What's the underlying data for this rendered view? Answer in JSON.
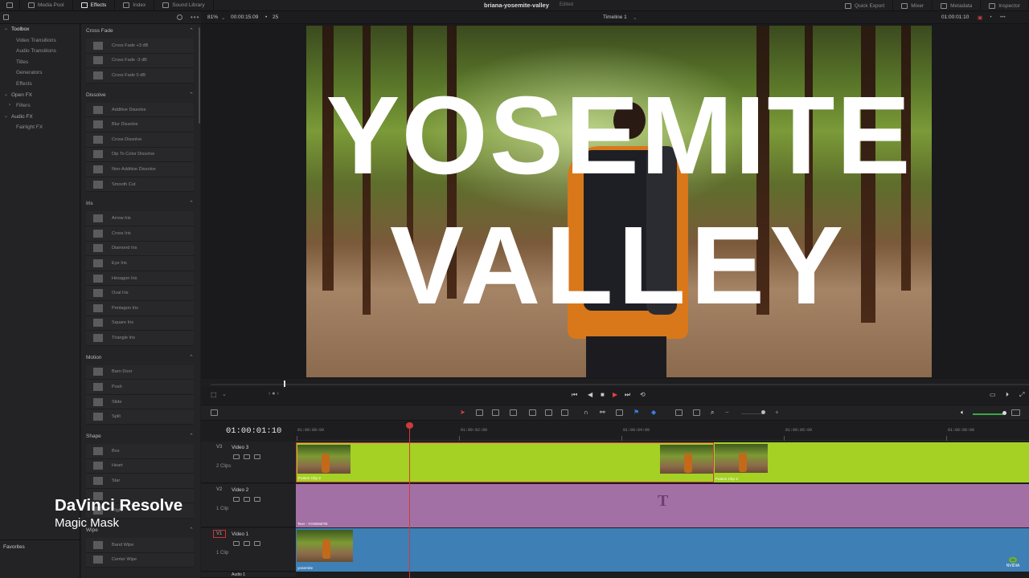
{
  "topbar": {
    "tabs": [
      {
        "label": "Media Pool",
        "icon": "media-pool-icon"
      },
      {
        "label": "Effects",
        "icon": "effects-icon",
        "active": true
      },
      {
        "label": "Index",
        "icon": "index-icon"
      },
      {
        "label": "Sound Library",
        "icon": "sound-library-icon"
      }
    ],
    "project_title": "briana-yosemite-valley",
    "project_state": "Edited",
    "right_tabs": [
      {
        "label": "Quick Export",
        "icon": "quick-export-icon"
      },
      {
        "label": "Mixer",
        "icon": "mixer-icon"
      },
      {
        "label": "Metadata",
        "icon": "metadata-icon"
      },
      {
        "label": "Inspector",
        "icon": "inspector-icon"
      }
    ]
  },
  "viewer_bar": {
    "zoom": "81%",
    "timecode": "00:00:15:09",
    "frame_rate": "25",
    "timeline_name": "Timeline 1",
    "current_tc": "01:00:01:10"
  },
  "sidebar": {
    "items": [
      {
        "label": "Toolbox",
        "level": 0,
        "expanded": true,
        "selected": true
      },
      {
        "label": "Video Transitions",
        "level": 1
      },
      {
        "label": "Audio Transitions",
        "level": 1
      },
      {
        "label": "Titles",
        "level": 1
      },
      {
        "label": "Generators",
        "level": 1
      },
      {
        "label": "Effects",
        "level": 1
      },
      {
        "label": "Open FX",
        "level": 0,
        "expanded": true
      },
      {
        "label": "Filters",
        "level": 1,
        "collapsed": true
      },
      {
        "label": "Audio FX",
        "level": 0,
        "expanded": true
      },
      {
        "label": "Fairlight FX",
        "level": 1
      }
    ],
    "favorites": "Favorites"
  },
  "effects": {
    "sections": [
      {
        "title": "Cross Fade",
        "items": [
          "Cross Fade +3 dB",
          "Cross Fade -3 dB",
          "Cross Fade 0 dB"
        ]
      },
      {
        "title": "Dissolve",
        "items": [
          "Additive Dissolve",
          "Blur Dissolve",
          "Cross Dissolve",
          "Dip To Color Dissolve",
          "Non-Additive Dissolve",
          "Smooth Cut"
        ]
      },
      {
        "title": "Iris",
        "items": [
          "Arrow Iris",
          "Cross Iris",
          "Diamond Iris",
          "Eye Iris",
          "Hexagon Iris",
          "Oval Iris",
          "Pentagon Iris",
          "Square Iris",
          "Triangle Iris"
        ]
      },
      {
        "title": "Motion",
        "items": [
          "Barn Door",
          "Push",
          "Slide",
          "Split"
        ]
      },
      {
        "title": "Shape",
        "items": [
          "Box",
          "Heart",
          "Star",
          "",
          "Flight"
        ]
      },
      {
        "title": "Wipe",
        "items": [
          "Band Wipe",
          "Center Wipe"
        ]
      }
    ]
  },
  "viewer": {
    "overlay_line1": "YOSEMITE",
    "overlay_line2": "VALLEY"
  },
  "timeline": {
    "timecode": "01:00:01:10",
    "ruler": [
      "01:00:00:00",
      "01:00:02:00",
      "01:00:04:00",
      "01:00:06:00",
      "01:00:08:00"
    ],
    "tracks": [
      {
        "id": "V3",
        "name": "Video 3",
        "clips_label": "2 Clips",
        "clip_a": "Fusion Clip 2",
        "clip_b": "Fusion Clip 2",
        "color": "#a4d124"
      },
      {
        "id": "V2",
        "name": "Video 2",
        "clips_label": "1 Clip",
        "clip_a": "Text - YOSEMITE",
        "color": "#a270a4"
      },
      {
        "id": "V1",
        "name": "Video 1",
        "clips_label": "1 Clip",
        "clip_a": "yosemite",
        "color": "#3e7fb6"
      }
    ],
    "next_track_label": "Audio 1"
  },
  "watermark": {
    "title": "DaVinci Resolve",
    "subtitle": "Magic Mask",
    "nvidia": "NVIDIA"
  }
}
